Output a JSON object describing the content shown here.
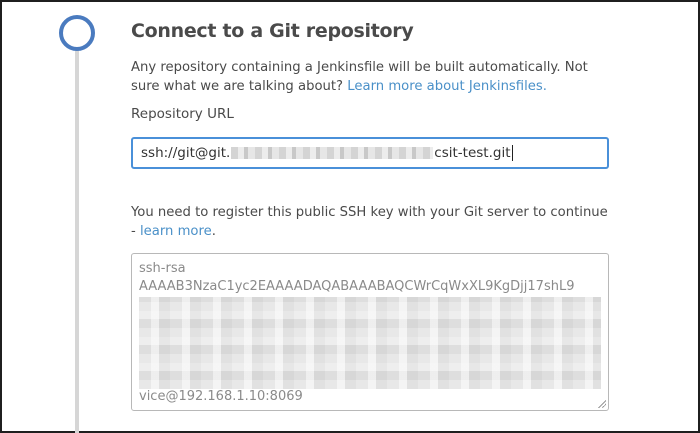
{
  "step": {
    "title": "Connect to a Git repository",
    "description_text": "Any repository containing a Jenkinsfile will be built automatically. Not sure what we are talking about?",
    "description_link": "Learn more about Jenkinsfiles."
  },
  "repository": {
    "label": "Repository URL",
    "url_prefix": "ssh://git@git.",
    "url_suffix": "csit-test.git"
  },
  "ssh": {
    "notice_text": "You need to register this public SSH key with your Git server to continue -",
    "notice_link": "learn more",
    "notice_end": ".",
    "key_line1": "ssh-rsa",
    "key_line2": "AAAAB3NzaC1yc2EAAAADAQABAAABAQCWrCqWxXL9KgDjj17shL9",
    "key_tail": "vice@192.168.1.10:8069"
  },
  "colors": {
    "accent": "#4a90c8",
    "timeline_node": "#4a7bbf",
    "input_focus": "#4a90d9"
  }
}
